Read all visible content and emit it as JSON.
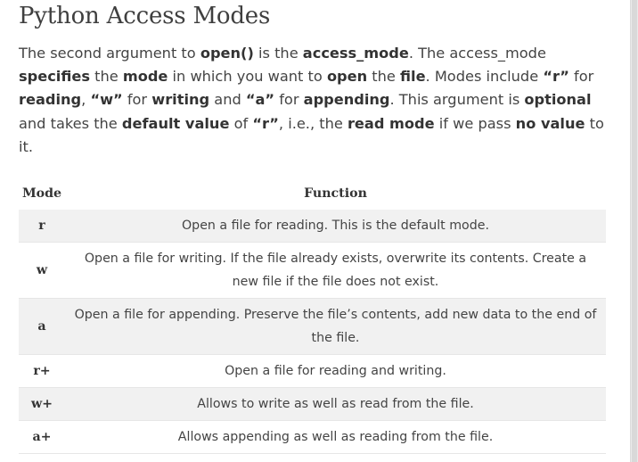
{
  "heading": "Python Access Modes",
  "intro": [
    {
      "t": "The second argument to ",
      "b": false
    },
    {
      "t": "open()",
      "b": true
    },
    {
      "t": " is the ",
      "b": false
    },
    {
      "t": "access_mode",
      "b": true
    },
    {
      "t": ". The access_mode ",
      "b": false
    },
    {
      "t": "specifies",
      "b": true
    },
    {
      "t": " the ",
      "b": false
    },
    {
      "t": "mode",
      "b": true
    },
    {
      "t": " in which you want to ",
      "b": false
    },
    {
      "t": "open",
      "b": true
    },
    {
      "t": " the ",
      "b": false
    },
    {
      "t": "file",
      "b": true
    },
    {
      "t": ". Modes include ",
      "b": false
    },
    {
      "t": "“r”",
      "b": true
    },
    {
      "t": " for ",
      "b": false
    },
    {
      "t": "reading",
      "b": true
    },
    {
      "t": ", ",
      "b": false
    },
    {
      "t": "“w”",
      "b": true
    },
    {
      "t": " for ",
      "b": false
    },
    {
      "t": "writing",
      "b": true
    },
    {
      "t": " and ",
      "b": false
    },
    {
      "t": "“a”",
      "b": true
    },
    {
      "t": " for ",
      "b": false
    },
    {
      "t": "appending",
      "b": true
    },
    {
      "t": ". This argument is ",
      "b": false
    },
    {
      "t": "optional",
      "b": true
    },
    {
      "t": " and takes the ",
      "b": false
    },
    {
      "t": "default value",
      "b": true
    },
    {
      "t": " of ",
      "b": false
    },
    {
      "t": "“r”",
      "b": true
    },
    {
      "t": ", i.e., the ",
      "b": false
    },
    {
      "t": "read mode",
      "b": true
    },
    {
      "t": " if we pass ",
      "b": false
    },
    {
      "t": "no value",
      "b": true
    },
    {
      "t": " to it.",
      "b": false
    }
  ],
  "table": {
    "headers": {
      "mode": "Mode",
      "function": "Function"
    },
    "rows": [
      {
        "mode": "r",
        "function": "Open a file for reading. This is the default mode."
      },
      {
        "mode": "w",
        "function": "Open a file for writing. If the file already exists, overwrite its contents. Create a new file if the file does not exist."
      },
      {
        "mode": "a",
        "function": "Open a file for appending. Preserve the file’s contents, add new data to the end of the file."
      },
      {
        "mode": "r+",
        "function": "Open a file for reading and writing."
      },
      {
        "mode": "w+",
        "function": "Allows to write as well as read from the file."
      },
      {
        "mode": "a+",
        "function": "Allows appending as well as reading from the file."
      }
    ]
  }
}
